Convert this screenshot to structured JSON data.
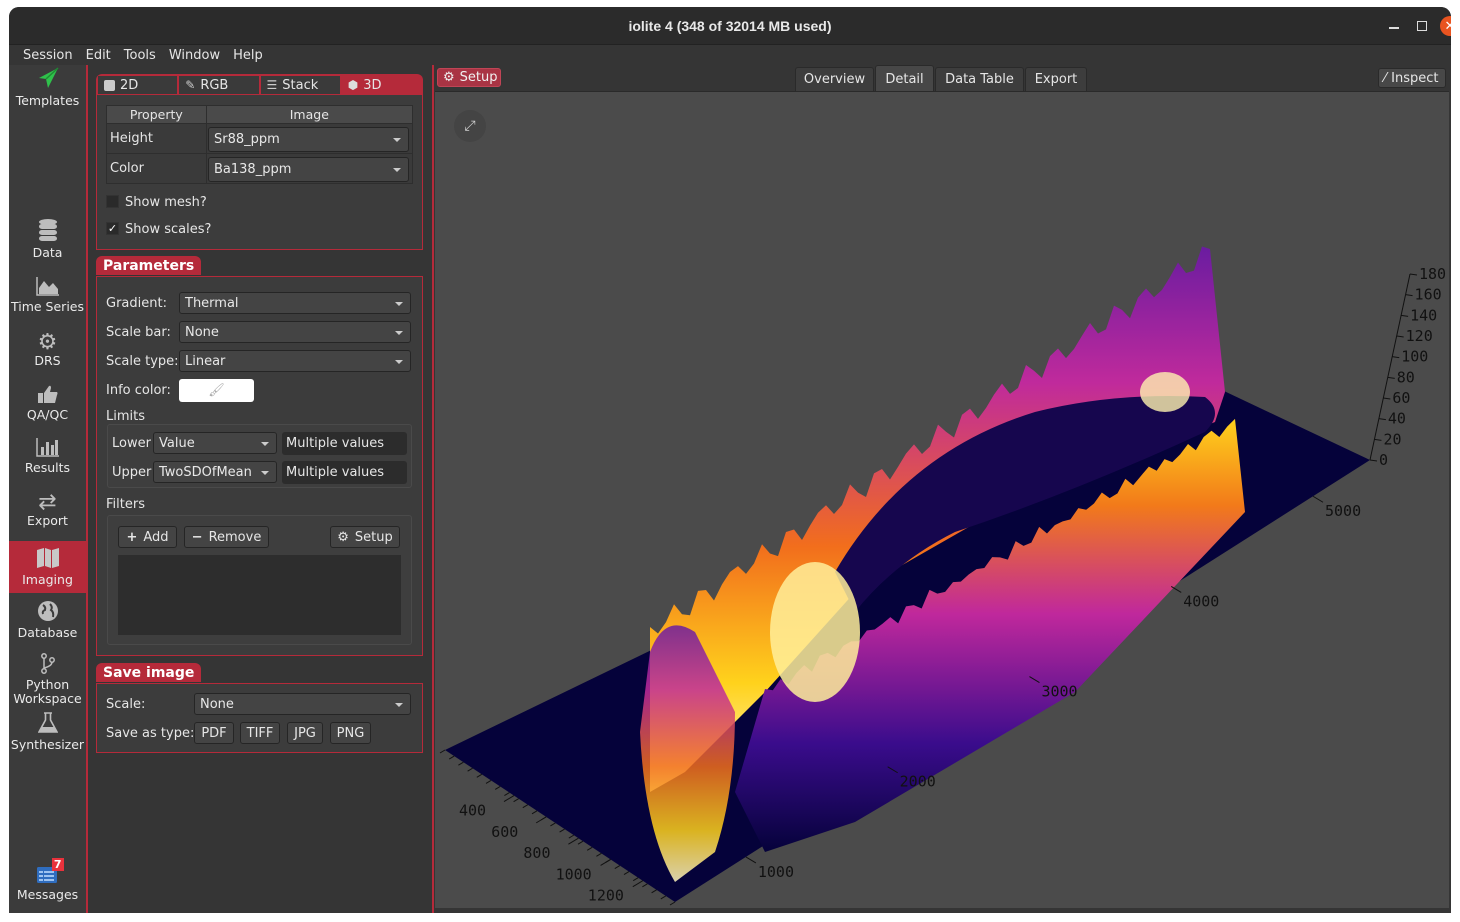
{
  "window": {
    "title": "iolite 4 (348 of 32014 MB used)",
    "controls": [
      "minimize",
      "maximize",
      "close"
    ]
  },
  "menubar": [
    "Session",
    "Edit",
    "Tools",
    "Window",
    "Help"
  ],
  "sidebar": {
    "items": [
      {
        "label": "Templates",
        "icon": "paper-plane-icon"
      },
      {
        "label": "Data",
        "icon": "database-icon"
      },
      {
        "label": "Time Series",
        "icon": "area-chart-icon"
      },
      {
        "label": "DRS",
        "icon": "gear-icon"
      },
      {
        "label": "QA/QC",
        "icon": "thumbs-up-icon"
      },
      {
        "label": "Results",
        "icon": "bar-chart-icon"
      },
      {
        "label": "Export",
        "icon": "exchange-icon"
      },
      {
        "label": "Imaging",
        "icon": "map-icon",
        "active": true
      },
      {
        "label": "Database",
        "icon": "globe-icon"
      },
      {
        "label": "Python Workspace",
        "icon": "git-branch-icon"
      },
      {
        "label": "Synthesizer",
        "icon": "flask-icon"
      }
    ],
    "messages": {
      "label": "Messages",
      "count": "7"
    }
  },
  "view_tabs": [
    {
      "label": "2D",
      "icon": "square-icon"
    },
    {
      "label": "RGB",
      "icon": "eyedropper-icon"
    },
    {
      "label": "Stack",
      "icon": "stack-icon"
    },
    {
      "label": "3D",
      "icon": "cube-icon",
      "active": true
    }
  ],
  "property_table": {
    "headers": [
      "Property",
      "Image"
    ],
    "rows": [
      {
        "property": "Height",
        "image": "Sr88_ppm"
      },
      {
        "property": "Color",
        "image": "Ba138_ppm"
      }
    ]
  },
  "options": {
    "show_mesh": {
      "label": "Show mesh?",
      "checked": false
    },
    "show_scales": {
      "label": "Show scales?",
      "checked": true
    }
  },
  "parameters": {
    "title": "Parameters",
    "gradient": {
      "label": "Gradient:",
      "value": "Thermal"
    },
    "scale_bar": {
      "label": "Scale bar:",
      "value": "None"
    },
    "scale_type": {
      "label": "Scale type:",
      "value": "Linear"
    },
    "info_color": {
      "label": "Info color:",
      "value": "#ffffff"
    },
    "limits": {
      "title": "Limits",
      "lower": {
        "label": "Lower",
        "mode": "Value",
        "value": "Multiple values"
      },
      "upper": {
        "label": "Upper",
        "mode": "TwoSDOfMean",
        "value": "Multiple values"
      }
    },
    "filters": {
      "title": "Filters",
      "add_label": "Add",
      "remove_label": "Remove",
      "setup_label": "Setup"
    }
  },
  "save_image": {
    "title": "Save image",
    "scale": {
      "label": "Scale:",
      "value": "None"
    },
    "save_as_label": "Save as type:",
    "types": [
      "PDF",
      "TIFF",
      "JPG",
      "PNG"
    ]
  },
  "main": {
    "setup_label": "Setup",
    "tabs": [
      {
        "label": "Overview"
      },
      {
        "label": "Detail",
        "active": true
      },
      {
        "label": "Data Table"
      },
      {
        "label": "Export"
      }
    ],
    "inspect_label": "Inspect"
  },
  "plot3d": {
    "colormap": "Thermal",
    "z_ticks": [
      "0",
      "20",
      "40",
      "60",
      "80",
      "100",
      "120",
      "140",
      "160",
      "180"
    ],
    "x_ticks": [
      "1000",
      "2000",
      "3000",
      "4000",
      "5000"
    ],
    "y_ticks": [
      "400",
      "600",
      "800",
      "1000",
      "1200"
    ]
  },
  "colors": {
    "accent": "#b52a3a",
    "background": "#353535",
    "viewport": "#4b4b4b",
    "close_button": "#e95420",
    "base_plane": "#05023a"
  }
}
